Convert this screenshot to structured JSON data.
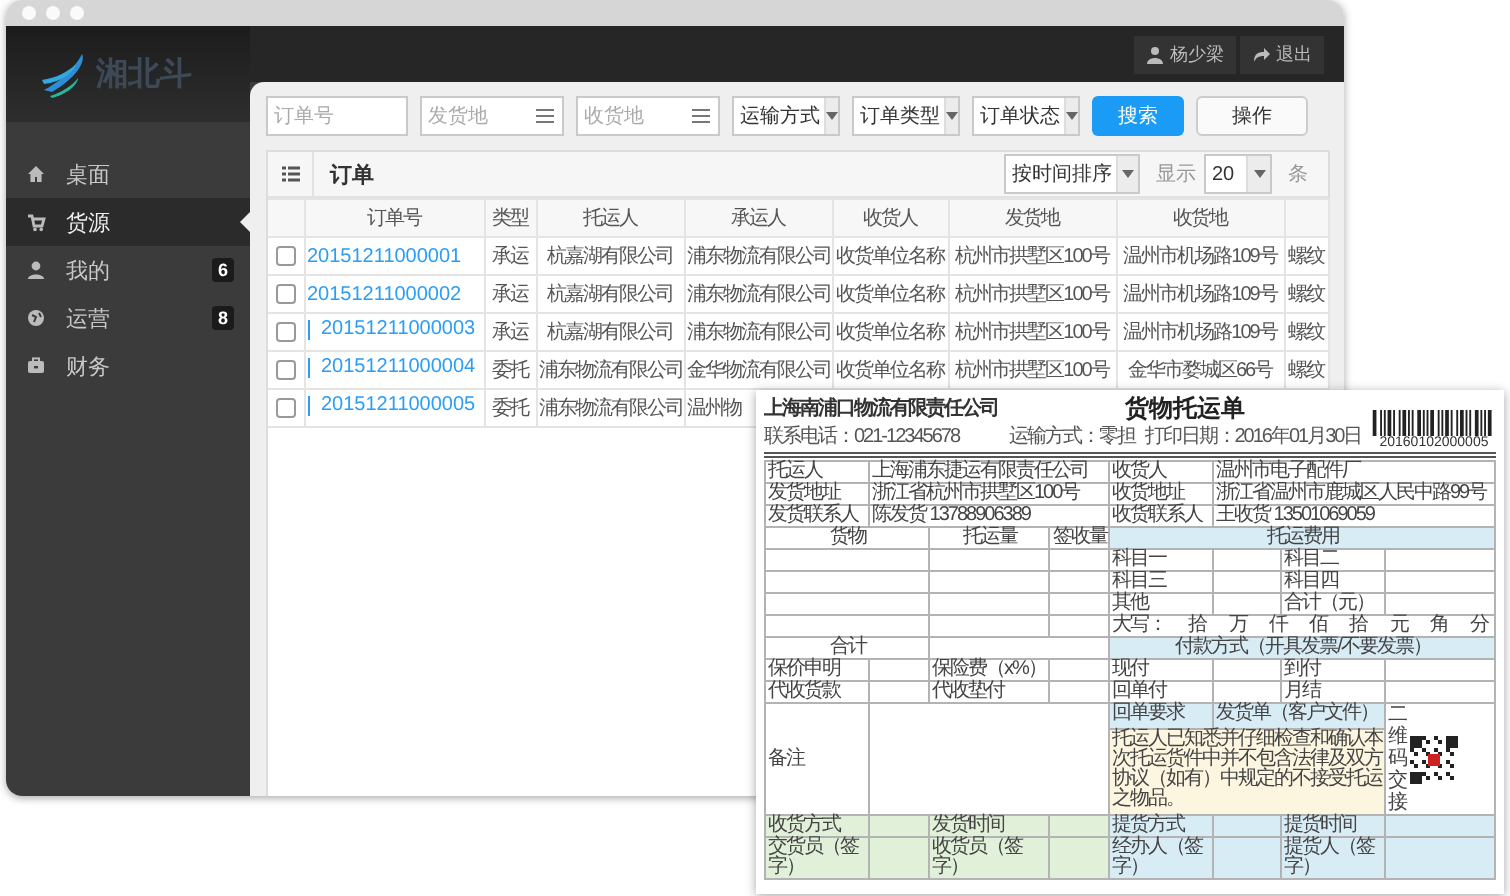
{
  "logo": {
    "text": "湘北斗"
  },
  "user_menu": [
    {
      "kind": "user",
      "label": "杨少梁"
    },
    {
      "kind": "logout",
      "label": "退出"
    }
  ],
  "sidebar": {
    "items": [
      {
        "kind": "home",
        "label": "桌面",
        "selected": false
      },
      {
        "kind": "cart",
        "label": "货源",
        "selected": true
      },
      {
        "kind": "user",
        "label": "我的",
        "selected": false,
        "badge": "6"
      },
      {
        "kind": "globe",
        "label": "运营",
        "selected": false,
        "badge": "8"
      },
      {
        "kind": "wallet",
        "label": "财务",
        "selected": false
      }
    ]
  },
  "filters": [
    {
      "kind": "text",
      "placeholder": "订单号"
    },
    {
      "kind": "picker",
      "placeholder": "发货地"
    },
    {
      "kind": "picker",
      "placeholder": "收货地"
    },
    {
      "kind": "select",
      "value": "运输方式"
    },
    {
      "kind": "select",
      "value": "订单类型"
    },
    {
      "kind": "select",
      "value": "订单状态"
    },
    {
      "kind": "primary",
      "label": "搜索"
    },
    {
      "kind": "plain",
      "label": "操作"
    }
  ],
  "table": {
    "title": "订单",
    "sort": "按时间排序",
    "show_label": "显示",
    "page_size": "20",
    "unit": "条",
    "columns": [
      "订单号",
      "类型",
      "托运人",
      "承运人",
      "收货人",
      "发货地",
      "收货地"
    ],
    "rows": [
      {
        "checked": false,
        "sub": false,
        "cells": [
          "20151211000001",
          "承运",
          "杭嘉湖有限公司",
          "浦东物流有限公司",
          "收货单位名称",
          "杭州市拱墅区100号",
          "温州市机场路109号",
          "螺纹"
        ]
      },
      {
        "checked": false,
        "sub": false,
        "cells": [
          "20151211000002",
          "承运",
          "杭嘉湖有限公司",
          "浦东物流有限公司",
          "收货单位名称",
          "杭州市拱墅区100号",
          "温州市机场路109号",
          "螺纹"
        ]
      },
      {
        "checked": false,
        "sub": true,
        "cells": [
          "20151211000003",
          "承运",
          "杭嘉湖有限公司",
          "浦东物流有限公司",
          "收货单位名称",
          "杭州市拱墅区100号",
          "温州市机场路109号",
          "螺纹"
        ]
      },
      {
        "checked": false,
        "sub": true,
        "cells": [
          "20151211000004",
          "委托",
          "浦东物流有限公司",
          "金华物流有限公司",
          "收货单位名称",
          "杭州市拱墅区100号",
          "金华市婺城区66号",
          "螺纹"
        ]
      },
      {
        "checked": false,
        "sub": true,
        "cells": [
          "20151211000005",
          "委托",
          "浦东物流有限公司",
          "温州物"
        ]
      }
    ]
  },
  "waybill": {
    "company": "上海南浦口物流有限责任公司",
    "phone": "联系电话：021-12345678",
    "title": "货物托运单",
    "transport": "运输方式：零担",
    "print_date": "打印日期：2016年01月30日",
    "barcode_number": "20160102000005",
    "party_rows": [
      {
        "left": {
          "label": "托运人",
          "value": "上海浦东捷运有限责任公司"
        },
        "right": {
          "label": "收货人",
          "value": "温州市电子配件厂"
        }
      },
      {
        "left": {
          "label": "发货地址",
          "value": "浙江省杭州市拱墅区100号"
        },
        "right": {
          "label": "收货地址",
          "value": "浙江省温州市鹿城区人民中路99号"
        }
      },
      {
        "left": {
          "label": "发货联系人",
          "value": "陈发货 13788906389"
        },
        "right": {
          "label": "收货联系人",
          "value": "王收货 13501069059"
        }
      }
    ],
    "goods_headings": [
      "货物",
      "托运量",
      "签收量"
    ],
    "fee_heading": "托运费用",
    "fee_rows": [
      {
        "left": "科目一",
        "right": "科目二"
      },
      {
        "left": "科目三",
        "right": "科目四"
      },
      {
        "left": "其他",
        "right": "合计（元）"
      }
    ],
    "amount_parts": [
      "大写：",
      "拾",
      "万",
      "仟",
      "佰",
      "拾",
      "元",
      "角",
      "分"
    ],
    "total_label": "合计",
    "payment_heading": "付款方式（开具发票/不要发票）",
    "option_rows": [
      [
        "保价申明",
        "保险费（x%）",
        "现付",
        "到付"
      ],
      [
        "代收货款",
        "代收垫付",
        "回单付",
        "月结"
      ]
    ],
    "remark_label": "备注",
    "receipt_label": "回单要求",
    "receipt_value": "发货单（客户文件）",
    "qr_caption": "二维码交接",
    "notice": "托运人已知悉并仔细检查和确认本次托运货件中并不包含法律及双方协议（如有）中规定的不接受托运之物品。",
    "sign_rows": [
      [
        "收货方式",
        "发货时间",
        "提货方式",
        "提货时间"
      ],
      [
        "交货员（签字）",
        "收货员（签字）",
        "经办人（签字）",
        "提货人（签字）"
      ]
    ]
  }
}
